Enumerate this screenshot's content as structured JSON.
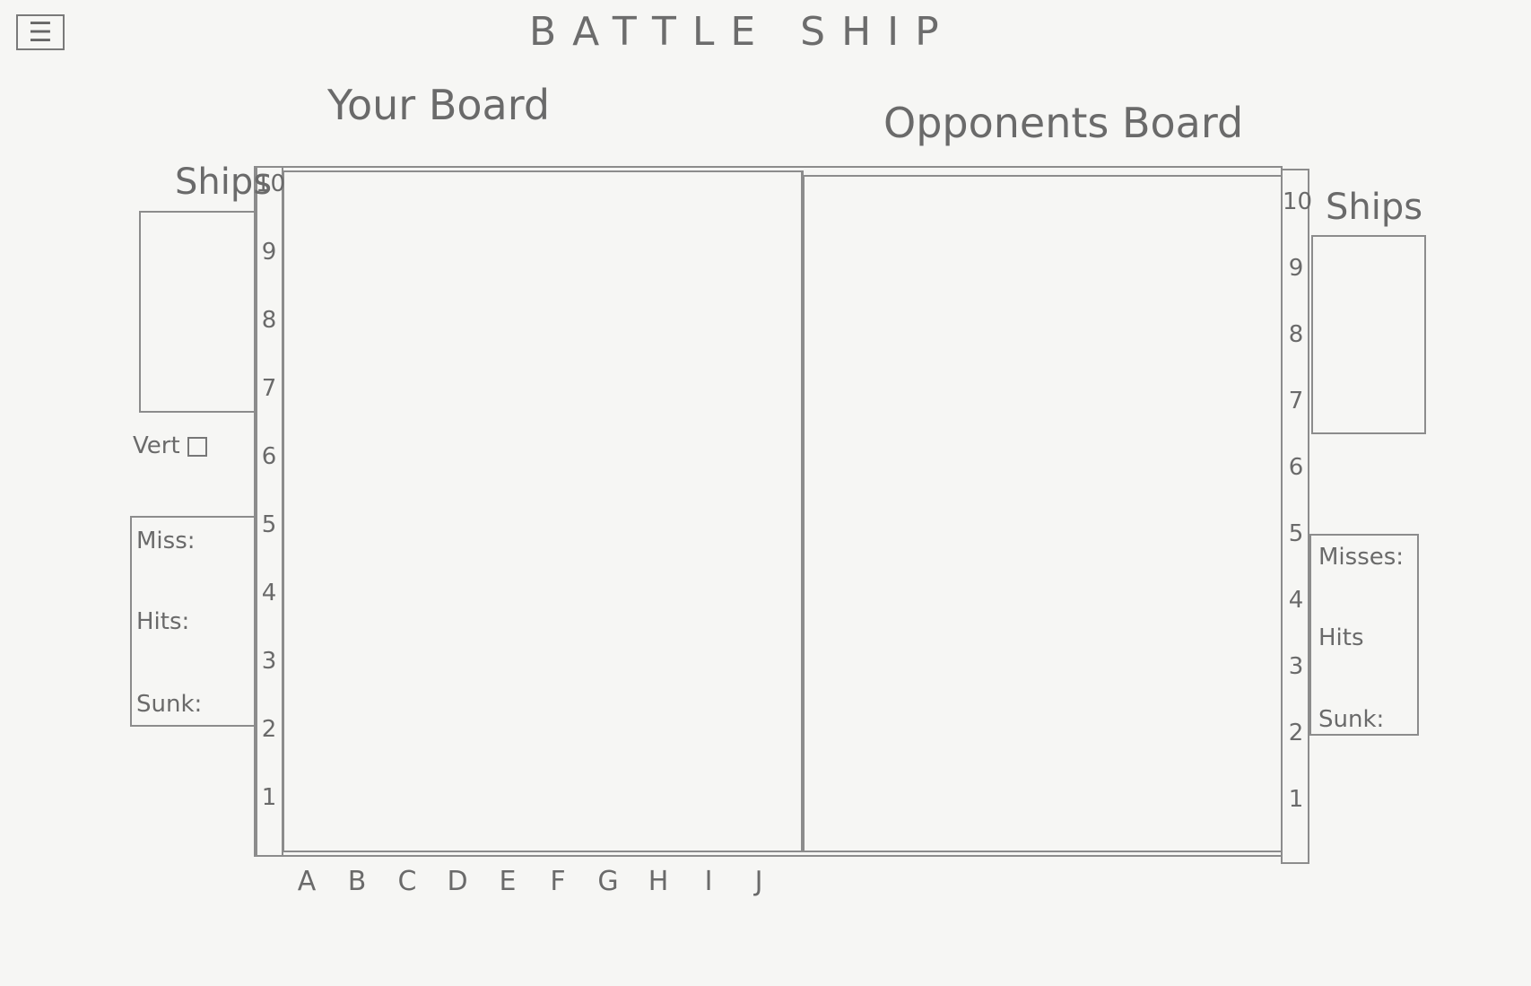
{
  "menu": {
    "icon": "menu-icon",
    "glyph": "☰"
  },
  "app_title": "BATTLE SHIP",
  "player": {
    "board_title": "Your Board",
    "ships_label": "Ships",
    "vert_label": "Vert",
    "stats": {
      "misses": "Miss:",
      "hits": "Hits:",
      "sunk": "Sunk:"
    },
    "rows": [
      "10",
      "9",
      "8",
      "7",
      "6",
      "5",
      "4",
      "3",
      "2",
      "1"
    ]
  },
  "opponent": {
    "board_title": "Opponents Board",
    "ships_label": "Ships",
    "stats": {
      "misses": "Misses:",
      "hits": "Hits",
      "sunk": "Sunk:"
    },
    "rows": [
      "10",
      "9",
      "8",
      "7",
      "6",
      "5",
      "4",
      "3",
      "2",
      "1"
    ]
  },
  "columns": [
    "A",
    "B",
    "C",
    "D",
    "E",
    "F",
    "G",
    "H",
    "I",
    "J"
  ]
}
